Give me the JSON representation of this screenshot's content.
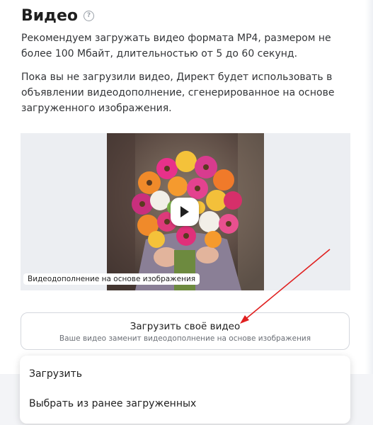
{
  "section": {
    "title": "Видео",
    "help_icon": "question-circle-icon",
    "recommendation": "Рекомендуем загружать видео формата MP4, размером не более 100 Мбайт, длительностью от 5 до 60 секунд.",
    "note": "Пока вы не загрузили видео, Директ будет использовать в объявлении видеодополнение, сгенерированное на основе загруженного изображения."
  },
  "preview": {
    "caption": "Видеодополнение на основе изображения",
    "play_icon": "play-icon"
  },
  "upload_button": {
    "label": "Загрузить своё видео",
    "sublabel": "Ваше видео заменит видеодополнение на основе изображения"
  },
  "dropdown": {
    "items": [
      {
        "label": "Загрузить"
      },
      {
        "label": "Выбрать из ранее загруженных"
      }
    ]
  },
  "colors": {
    "annotation_arrow": "#e02020",
    "preview_bg": "#eceef2"
  }
}
